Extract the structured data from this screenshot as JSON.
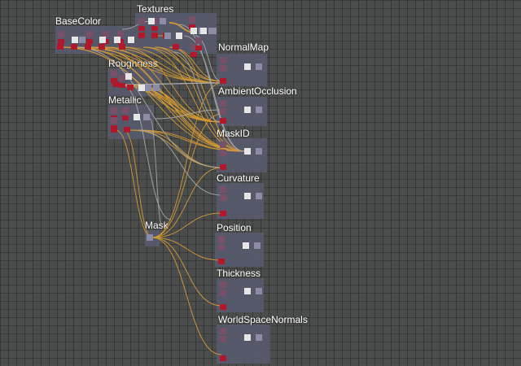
{
  "editor": {
    "colors": {
      "background": "#4a4d4b",
      "grid": "#3a3c3b",
      "frame": "#575a6b",
      "node_body": "#7a5068",
      "node_input_red": "#b0182c",
      "node_white": "#e6e6e6",
      "node_output": "#8c8ca6",
      "wire_orange": "#d69a35",
      "wire_gray": "#a7aaa9"
    },
    "frames": [
      {
        "id": "basecolor",
        "label": "BaseColor"
      },
      {
        "id": "textures",
        "label": "Textures"
      },
      {
        "id": "roughness",
        "label": "Roughness"
      },
      {
        "id": "metallic",
        "label": "Metallic"
      },
      {
        "id": "normalmap",
        "label": "NormalMap"
      },
      {
        "id": "ao",
        "label": "AmbientOcclusion"
      },
      {
        "id": "maskid",
        "label": "MaskID"
      },
      {
        "id": "curvature",
        "label": "Curvature"
      },
      {
        "id": "mask",
        "label": "Mask"
      },
      {
        "id": "position",
        "label": "Position"
      },
      {
        "id": "thickness",
        "label": "Thickness"
      },
      {
        "id": "wsn",
        "label": "WorldSpaceNormals"
      }
    ]
  }
}
